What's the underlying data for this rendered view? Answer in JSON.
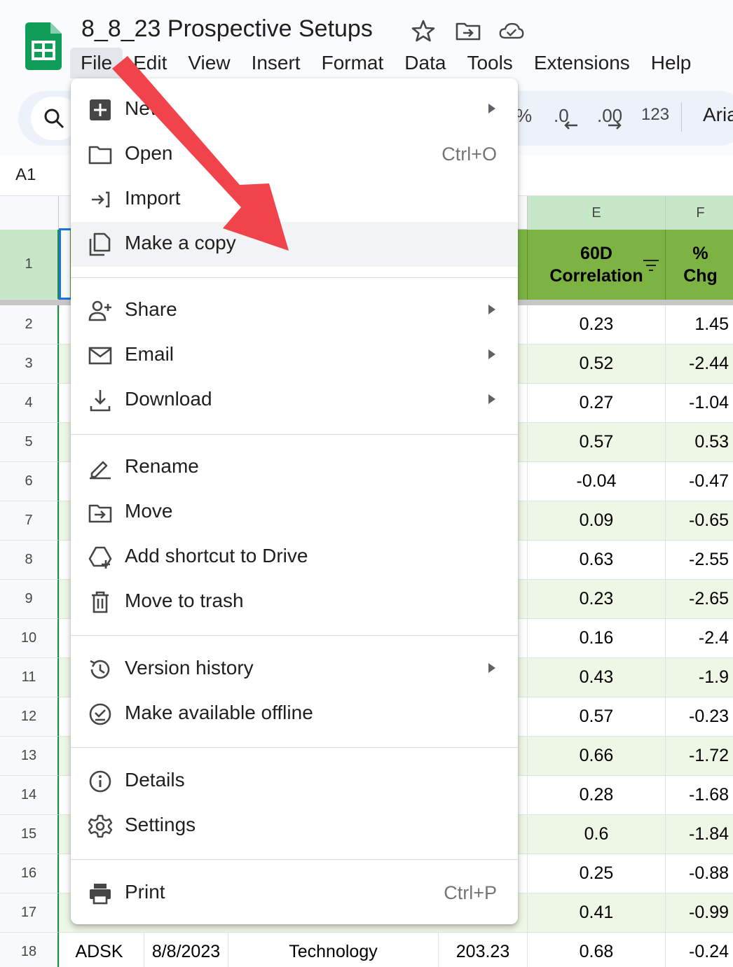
{
  "doc": {
    "title": "8_8_23 Prospective Setups",
    "title_icons": [
      "star-icon",
      "move-folder-icon",
      "cloud-saved-icon"
    ]
  },
  "menubar": [
    "File",
    "Edit",
    "View",
    "Insert",
    "Format",
    "Data",
    "Tools",
    "Extensions",
    "Help"
  ],
  "toolbar": {
    "percent": "%",
    "dec_decrease": ".0",
    "dec_increase": ".00",
    "number_format": "123",
    "font": "Aria"
  },
  "namebox": "A1",
  "columns": {
    "e": "E",
    "f": "F"
  },
  "header_row": {
    "e_line1": "60D",
    "e_line2": "Correlation",
    "f_line1": "%",
    "f_line2": "Chg"
  },
  "rows": [
    {
      "n": "1"
    },
    {
      "n": "2",
      "e": "0.23",
      "f": "1.45"
    },
    {
      "n": "3",
      "e": "0.52",
      "f": "-2.44"
    },
    {
      "n": "4",
      "e": "0.27",
      "f": "-1.04"
    },
    {
      "n": "5",
      "e": "0.57",
      "f": "0.53"
    },
    {
      "n": "6",
      "e": "-0.04",
      "f": "-0.47"
    },
    {
      "n": "7",
      "e": "0.09",
      "f": "-0.65"
    },
    {
      "n": "8",
      "e": "0.63",
      "f": "-2.55"
    },
    {
      "n": "9",
      "e": "0.23",
      "f": "-2.65"
    },
    {
      "n": "10",
      "e": "0.16",
      "f": "-2.4"
    },
    {
      "n": "11",
      "e": "0.43",
      "f": "-1.9"
    },
    {
      "n": "12",
      "e": "0.57",
      "f": "-0.23"
    },
    {
      "n": "13",
      "e": "0.66",
      "f": "-1.72"
    },
    {
      "n": "14",
      "e": "0.28",
      "f": "-1.68"
    },
    {
      "n": "15",
      "e": "0.6",
      "f": "-1.84"
    },
    {
      "n": "16",
      "e": "0.25",
      "f": "-0.88"
    },
    {
      "n": "17",
      "e": "0.41",
      "f": "-0.99"
    },
    {
      "n": "18",
      "e": "0.68",
      "f": "-0.24",
      "a": "ADSK",
      "b": "8/8/2023",
      "c": "Technology",
      "d": "203.23"
    }
  ],
  "file_menu": {
    "new": "New",
    "open": "Open",
    "open_shortcut": "Ctrl+O",
    "import": "Import",
    "make_copy": "Make a copy",
    "share": "Share",
    "email": "Email",
    "download": "Download",
    "rename": "Rename",
    "move": "Move",
    "add_shortcut": "Add shortcut to Drive",
    "trash": "Move to trash",
    "version_history": "Version history",
    "offline": "Make available offline",
    "details": "Details",
    "settings": "Settings",
    "print": "Print",
    "print_shortcut": "Ctrl+P"
  },
  "colors": {
    "accent": "#1a73e8",
    "sheets_green": "#0f9d58",
    "header_green": "#7cb342",
    "band_green": "#eef6e6",
    "arrow_red": "#f0434b"
  }
}
